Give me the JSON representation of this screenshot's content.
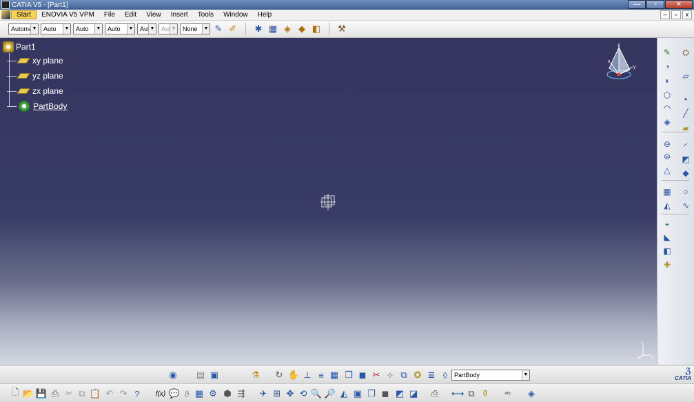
{
  "window": {
    "title": "CATIA V5 - [Part1]",
    "controls": {
      "minimize": "—",
      "restore": "▫",
      "close": "✕"
    }
  },
  "menu": {
    "items": [
      "Start",
      "ENOVIA V5 VPM",
      "File",
      "Edit",
      "View",
      "Insert",
      "Tools",
      "Window",
      "Help"
    ]
  },
  "toolbar": {
    "combos": [
      {
        "value": "Automa",
        "disabled": false
      },
      {
        "value": "Auto",
        "disabled": false
      },
      {
        "value": "Auto",
        "disabled": false
      },
      {
        "value": "Auto",
        "disabled": false
      },
      {
        "value": "Aut",
        "disabled": false
      },
      {
        "value": "Aut",
        "disabled": true
      },
      {
        "value": "None",
        "disabled": false
      }
    ]
  },
  "tree": {
    "root": "Part1",
    "children": [
      {
        "label": "xy plane",
        "icon": "plane-icon"
      },
      {
        "label": "yz plane",
        "icon": "plane-icon"
      },
      {
        "label": "zx plane",
        "icon": "plane-icon"
      },
      {
        "label": "PartBody",
        "icon": "gear-icon"
      }
    ]
  },
  "compass": {
    "x_label": "x",
    "y_label": "y",
    "z_label": "z"
  },
  "bottom": {
    "current_body": "PartBody",
    "logo_text": "CATIA"
  },
  "colors": {
    "viewport_top": "#35355f",
    "viewport_bottom": "#d4d8e2",
    "start_highlight": "#f7d35a"
  }
}
